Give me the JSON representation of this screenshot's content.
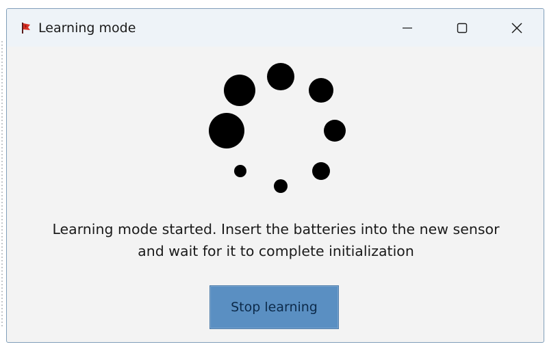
{
  "window": {
    "title": "Learning mode",
    "icon": "red-flag-app-icon",
    "controls": {
      "minimize_icon": "minimize-icon",
      "maximize_icon": "maximize-icon",
      "close_icon": "close-icon"
    }
  },
  "spinner": {
    "icon": "loading-spinner-icon",
    "color": "#000000"
  },
  "message": {
    "line1": "Learning mode started. Insert the batteries into the new sensor",
    "line2": "and wait for it to complete initialization"
  },
  "buttons": {
    "stop_label": "Stop learning"
  },
  "colors": {
    "titlebar": "#eef3f8",
    "window_bg": "#f3f3f3",
    "button_bg": "#5a8fc2",
    "button_text": "#0c2a4a",
    "icon_red": "#d93025"
  }
}
